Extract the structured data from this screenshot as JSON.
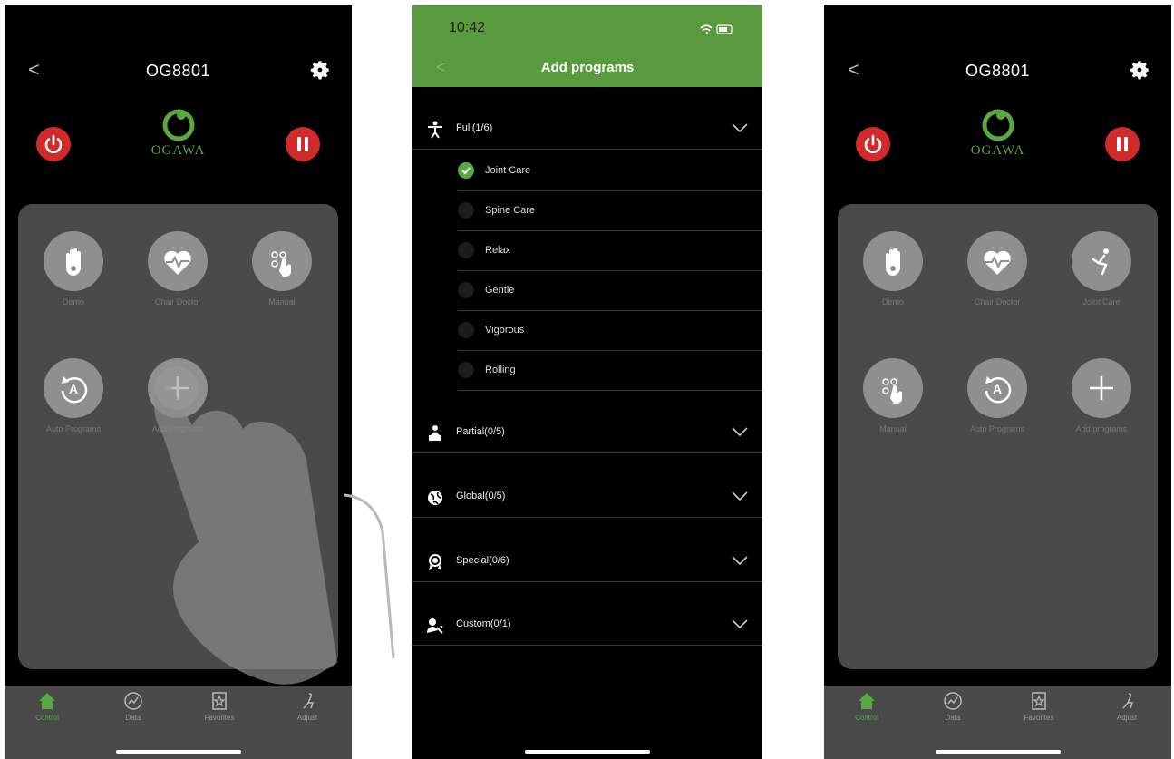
{
  "screen_left": {
    "header": {
      "back_glyph": "<",
      "title": "OG8801",
      "settings_icon": "gear-icon"
    },
    "logo": {
      "text": "OGAWA"
    },
    "tiles": [
      {
        "icon": "hand-icon",
        "label": "Demo"
      },
      {
        "icon": "heart-pulse-icon",
        "label": "Chair Doctor"
      },
      {
        "icon": "manual-touch-icon",
        "label": "Manual"
      },
      {
        "icon": "auto-program-icon",
        "label": "Auto Programs"
      },
      {
        "icon": "plus-icon",
        "label": "Add programs"
      }
    ],
    "tabs": [
      {
        "icon": "home-icon",
        "label": "Control"
      },
      {
        "icon": "chart-icon",
        "label": "Data"
      },
      {
        "icon": "star-icon",
        "label": "Favorites"
      },
      {
        "icon": "chair-icon",
        "label": "Adjust"
      }
    ]
  },
  "screen_middle": {
    "status_time": "10:42",
    "back_glyph": "<",
    "title": "Add programs",
    "categories": [
      {
        "icon": "person-icon",
        "label": "Full(1/6)",
        "expanded": true
      },
      {
        "icon": "partial-body-icon",
        "label": "Partial(0/5)",
        "expanded": false
      },
      {
        "icon": "globe-icon",
        "label": "Global(0/5)",
        "expanded": false
      },
      {
        "icon": "award-icon",
        "label": "Special(0/6)",
        "expanded": false
      },
      {
        "icon": "user-custom-icon",
        "label": "Custom(0/1)",
        "expanded": false
      }
    ],
    "programs": [
      {
        "label": "Joint Care",
        "selected": true
      },
      {
        "label": "Spine Care",
        "selected": false
      },
      {
        "label": "Relax",
        "selected": false
      },
      {
        "label": "Gentle",
        "selected": false
      },
      {
        "label": "Vigorous",
        "selected": false
      },
      {
        "label": "Rolling",
        "selected": false
      }
    ]
  },
  "screen_right": {
    "header": {
      "back_glyph": "<",
      "title": "OG8801",
      "settings_icon": "gear-icon"
    },
    "logo": {
      "text": "OGAWA"
    },
    "tiles": [
      {
        "icon": "hand-icon",
        "label": "Demo"
      },
      {
        "icon": "heart-pulse-icon",
        "label": "Chair Doctor"
      },
      {
        "icon": "joint-care-icon",
        "label": "Joint Care"
      },
      {
        "icon": "manual-touch-icon",
        "label": "Manual"
      },
      {
        "icon": "auto-program-icon",
        "label": "Auto Programs"
      },
      {
        "icon": "plus-icon",
        "label": "Add programs"
      }
    ],
    "tabs": [
      {
        "icon": "home-icon",
        "label": "Control"
      },
      {
        "icon": "chart-icon",
        "label": "Data"
      },
      {
        "icon": "star-icon",
        "label": "Favorites"
      },
      {
        "icon": "chair-icon",
        "label": "Adjust"
      }
    ]
  },
  "colors": {
    "accent_green": "#58a93f",
    "header_green": "#5a9a3e",
    "power_red": "#d12a2a",
    "panel_gray": "#4a4a4a",
    "tile_gray": "#8f8f8f"
  }
}
